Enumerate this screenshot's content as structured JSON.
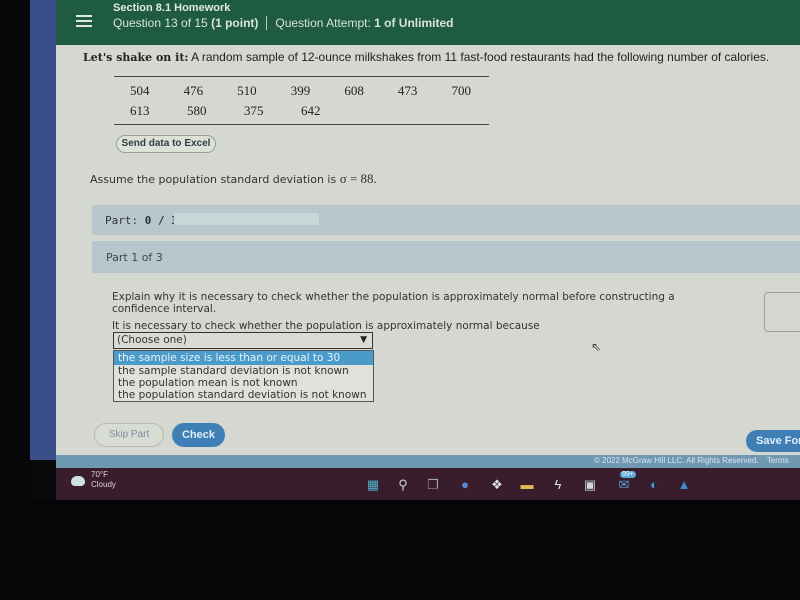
{
  "header": {
    "section_title": "Section 8.1 Homework",
    "question_prefix": "Question 13 of 15",
    "points": "(1 point)",
    "attempt_label": "Question Attempt:",
    "attempt_value": "1 of Unlimited"
  },
  "problem": {
    "lead": "Let's shake on it:",
    "text": "A random sample of 12-ounce milkshakes from 11 fast-food restaurants had the following number of calories.",
    "data_rows": [
      [
        "504",
        "476",
        "510",
        "399",
        "608",
        "473",
        "700"
      ],
      [
        "613",
        "580",
        "375",
        "642"
      ]
    ],
    "excel_button": "Send data to Excel",
    "assumption_text": "Assume the population standard deviation is ",
    "assumption_math": "σ = 88."
  },
  "part_progress": {
    "label": "Part:",
    "value": "0 / 3",
    "fraction_complete": 0
  },
  "part_header": "Part 1 of 3",
  "question": {
    "prompt": "Explain why it is necessary to check whether the population is approximately normal before constructing a confidence interval.",
    "stem": "It is necessary to check whether the population is approximately normal because",
    "select_value": "(Choose one)",
    "options": [
      "the sample size is less than or equal to 30",
      "the sample standard deviation is not known",
      "the population mean is not known",
      "the population standard deviation is not known"
    ],
    "highlighted_option_index": 0
  },
  "actions": {
    "skip": "Skip Part",
    "check": "Check",
    "save": "Save For"
  },
  "footer": {
    "copyright": "© 2022 McGraw Hill LLC. All Rights Reserved.",
    "terms": "Terms"
  },
  "taskbar": {
    "weather_temp": "70°F",
    "weather_condition": "Cloudy",
    "mail_badge": "99+"
  }
}
